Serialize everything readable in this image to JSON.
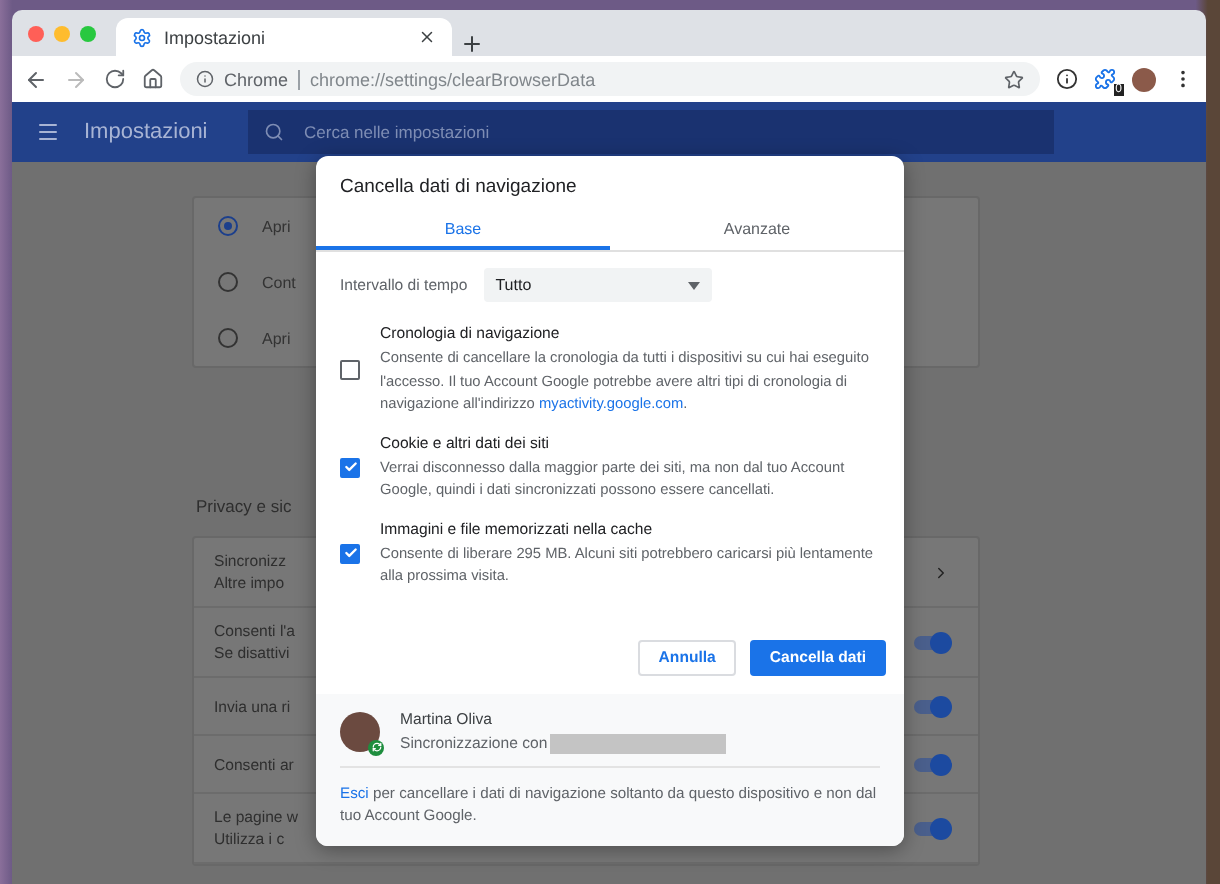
{
  "window": {
    "tab_title": "Impostazioni",
    "site_label": "Chrome",
    "url": "chrome://settings/clearBrowserData",
    "extension_badge": "0"
  },
  "header": {
    "title": "Impostazioni",
    "search_placeholder": "Cerca nelle impostazioni"
  },
  "startup_options": [
    {
      "label": "Apri",
      "selected": true
    },
    {
      "label": "Cont",
      "selected": false
    },
    {
      "label": "Apri",
      "selected": false
    }
  ],
  "privacy": {
    "title": "Privacy e sic",
    "rows": [
      {
        "kind": "link",
        "title": "Sincronizz",
        "subtitle": "Altre impo"
      },
      {
        "kind": "toggle",
        "title": "Consenti l'a",
        "subtitle": "Se disattivi",
        "on": true
      },
      {
        "kind": "toggle",
        "title": "Invia una ri",
        "on": true
      },
      {
        "kind": "toggle",
        "title": "Consenti ar",
        "on": true
      },
      {
        "kind": "toggle",
        "title": "Le pagine w",
        "subtitle": "Utilizza i c",
        "on": true
      }
    ]
  },
  "dialog": {
    "title": "Cancella dati di navigazione",
    "tabs": [
      {
        "label": "Base",
        "selected": true
      },
      {
        "label": "Avanzate",
        "selected": false
      }
    ],
    "time_range": {
      "label": "Intervallo di tempo",
      "value": "Tutto"
    },
    "items": [
      {
        "title": "Cronologia di navigazione",
        "description": "Consente di cancellare la cronologia da tutti i dispositivi su cui hai eseguito l'accesso. Il tuo Account Google potrebbe avere altri tipi di cronologia di navigazione all'indirizzo",
        "link": "myactivity.google.com",
        "description_end": ".",
        "checked": false
      },
      {
        "title": "Cookie e altri dati dei siti",
        "description": "Verrai disconnesso dalla maggior parte dei siti, ma non dal tuo Account Google, quindi i dati sincronizzati possono essere cancellati.",
        "checked": true
      },
      {
        "title": "Immagini e file memorizzati nella cache",
        "description": "Consente di liberare 295 MB. Alcuni siti potrebbero caricarsi più lentamente alla prossima visita.",
        "checked": true
      }
    ],
    "buttons": [
      {
        "label": "Annulla",
        "kind": "secondary"
      },
      {
        "label": "Cancella dati",
        "kind": "primary"
      }
    ],
    "account": {
      "name": "Martina Oliva",
      "sync_label": "Sincronizzazione con"
    },
    "footer": {
      "link": "Esci",
      "text": "per cancellare i dati di navigazione soltanto da questo dispositivo e non dal tuo Account Google."
    }
  }
}
